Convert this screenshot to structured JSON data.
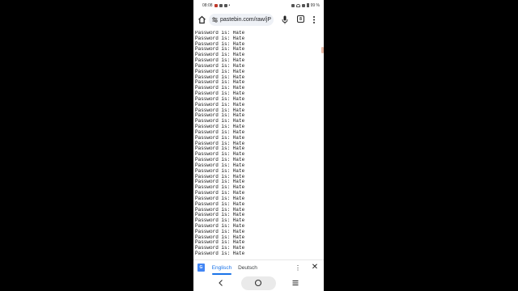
{
  "status_bar": {
    "time": "08:08",
    "battery": "99 %",
    "icons": [
      "notification-icon",
      "message-icon",
      "mail-icon",
      "more-icon",
      "alarm-icon",
      "wifi-icon",
      "signal-icon",
      "battery-icon"
    ]
  },
  "browser": {
    "url": "pastebin.com/raw/jP",
    "tab_count": "8",
    "icons": [
      "home-icon",
      "site-info-icon",
      "mic-icon",
      "tabs-icon",
      "menu-icon"
    ]
  },
  "content": {
    "line_text": "Password is: Hate",
    "visible_line_count": 41
  },
  "translate_bar": {
    "source_language": "Englisch",
    "target_language": "Deutsch",
    "accent_color": "#1a73e8"
  },
  "nav_bar": {
    "icons": [
      "back-icon",
      "home-circle-icon",
      "recents-icon"
    ]
  }
}
